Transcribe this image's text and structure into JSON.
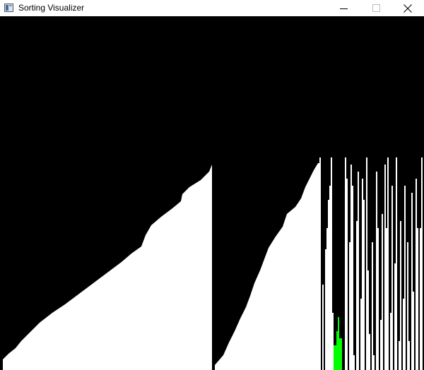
{
  "window": {
    "title": "Sorting Visualizer",
    "icon": "app-window-icon",
    "controls": [
      {
        "name": "minimize",
        "icon": "minimize-icon"
      },
      {
        "name": "maximize",
        "icon": "maximize-icon"
      },
      {
        "name": "close",
        "icon": "close-icon"
      }
    ]
  },
  "colors": {
    "background": "#000000",
    "bar": "#ffffff",
    "highlight": "#00ff00"
  }
}
